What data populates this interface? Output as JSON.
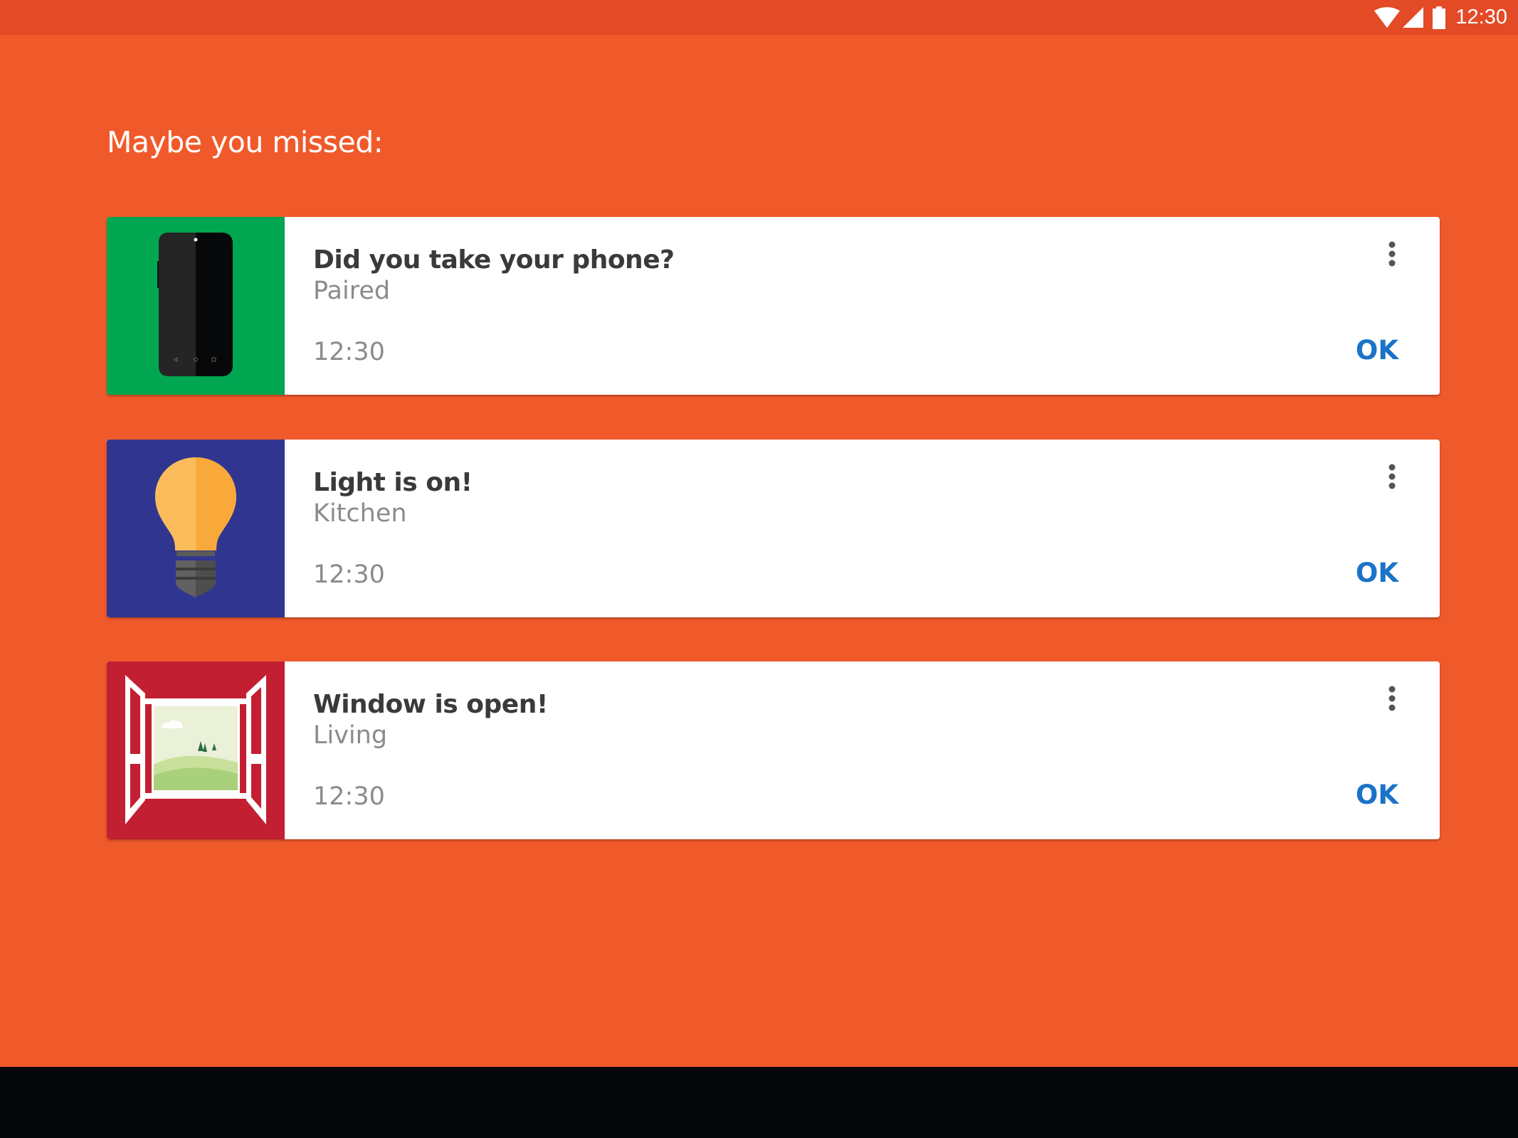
{
  "status_bar": {
    "time": "12:30",
    "icons": [
      "wifi-icon",
      "signal-icon",
      "battery-icon"
    ]
  },
  "heading": "Maybe you missed:",
  "cards": [
    {
      "title": "Did you take your phone?",
      "subtitle": "Paired",
      "time": "12:30",
      "action": "OK",
      "icon": "phone-icon",
      "thumb_color": "#00a650"
    },
    {
      "title": "Light is on!",
      "subtitle": "Kitchen",
      "time": "12:30",
      "action": "OK",
      "icon": "lightbulb-icon",
      "thumb_color": "#303690"
    },
    {
      "title": "Window is open!",
      "subtitle": "Living",
      "time": "12:30",
      "action": "OK",
      "icon": "window-icon",
      "thumb_color": "#c22032"
    }
  ],
  "colors": {
    "background": "#f05a2b",
    "status_bar": "#e34a26",
    "action": "#1a73c8",
    "nav_bar": "#060709"
  }
}
